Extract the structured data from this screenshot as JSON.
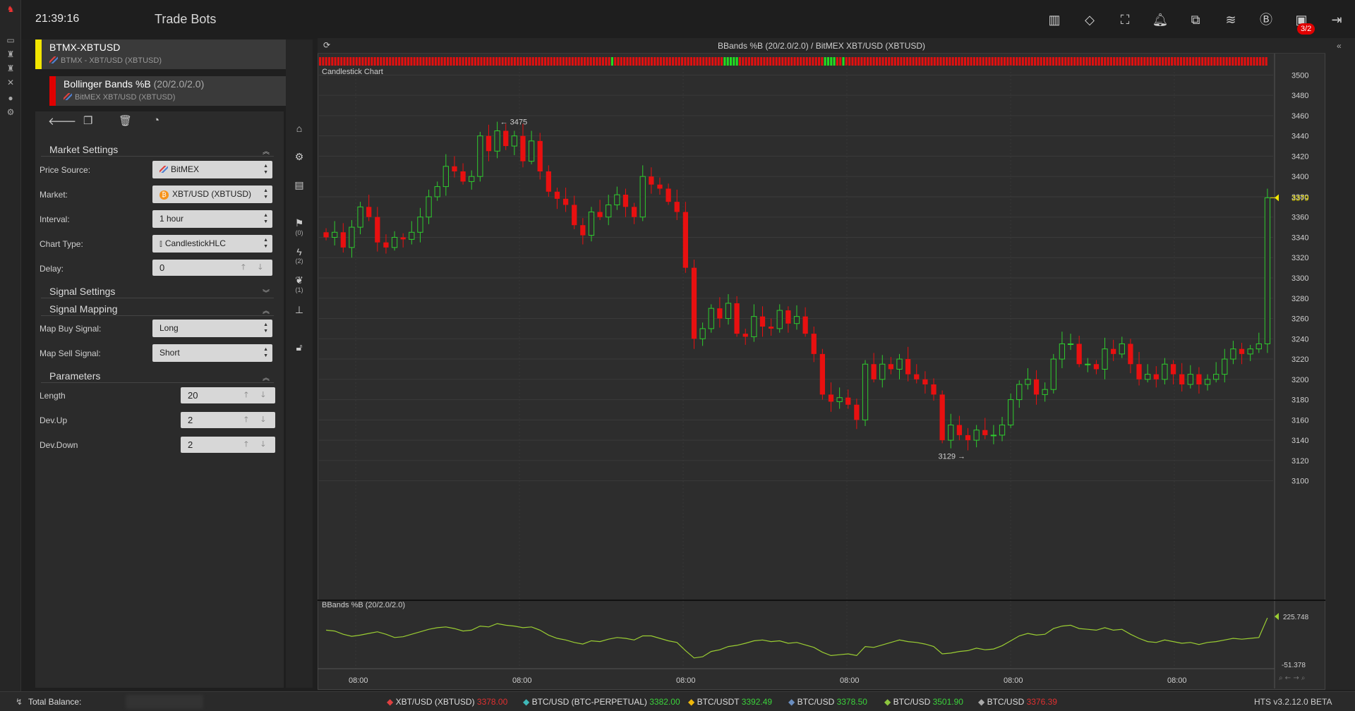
{
  "header": {
    "clock": "21:39:16",
    "title": "Trade Bots",
    "icons": [
      "map-icon",
      "tag-icon",
      "screenshot-icon",
      "bell-icon",
      "ticket-icon",
      "coins-icon",
      "bitcoin-sync-icon",
      "inbox-icon",
      "logout-icon"
    ],
    "badge": "3/2"
  },
  "bots": [
    {
      "name": "BTMX-XBTUSD",
      "sub": "BTMX - XBT/USD (XBTUSD)",
      "stripe_color": "#f2e600"
    },
    {
      "name": "Bollinger Bands %B",
      "params": "(20/2.0/2.0)",
      "sub": "BitMEX XBT/USD (XBTUSD)",
      "stripe_color": "#e00000"
    }
  ],
  "market_settings": {
    "title": "Market Settings",
    "price_source": {
      "label": "Price Source:",
      "value": "BitMEX"
    },
    "market": {
      "label": "Market:",
      "value": "XBT/USD (XBTUSD)"
    },
    "interval": {
      "label": "Interval:",
      "value": "1 hour"
    },
    "chart_type": {
      "label": "Chart Type:",
      "value": "CandlestickHLC"
    },
    "delay": {
      "label": "Delay:",
      "value": "0"
    }
  },
  "signal_settings": {
    "title": "Signal Settings"
  },
  "signal_mapping": {
    "title": "Signal Mapping",
    "buy": {
      "label": "Map Buy Signal:",
      "value": "Long"
    },
    "sell": {
      "label": "Map Sell Signal:",
      "value": "Short"
    }
  },
  "parameters": {
    "title": "Parameters",
    "length": {
      "label": "Length",
      "value": "20"
    },
    "dev_up": {
      "label": "Dev.Up",
      "value": "2"
    },
    "dev_down": {
      "label": "Dev.Down",
      "value": "2"
    }
  },
  "mid_tools": [
    {
      "icon": "home-icon"
    },
    {
      "icon": "gears-icon"
    },
    {
      "icon": "money-icon"
    },
    {
      "icon": "flag-icon",
      "count": "(0)"
    },
    {
      "icon": "lightning-icon",
      "count": "(2)"
    },
    {
      "icon": "leaf-icon",
      "count": "(1)"
    },
    {
      "icon": "sitemap-icon"
    },
    {
      "icon": "unlock-icon"
    }
  ],
  "chart": {
    "title": "BBands %B (20/2.0/2.0) / BitMEX XBT/USD (XBTUSD)",
    "main_label": "Candlestick Chart",
    "sub_label": "BBands %B (20/2.0/2.0)",
    "high_marker": "3475",
    "low_marker": "3129",
    "last_price": "3379",
    "sub_top_value": "225.748",
    "sub_bottom_value": "-51.378",
    "colors": {
      "up": "#2ecc2e",
      "down": "#e81010",
      "indicator": "#9acd32"
    }
  },
  "chart_data": {
    "type": "candlestick",
    "ylim": [
      3090,
      3510
    ],
    "y_ticks": [
      "3500",
      "3480",
      "3460",
      "3440",
      "3420",
      "3400",
      "3380",
      "3360",
      "3340",
      "3320",
      "3300",
      "3280",
      "3260",
      "3240",
      "3220",
      "3200",
      "3180",
      "3160",
      "3140",
      "3120",
      "3100"
    ],
    "x_ticks": [
      "08:00",
      "08:00",
      "08:00",
      "08:00",
      "08:00",
      "08:00"
    ],
    "close": [
      3340,
      3345,
      3330,
      3350,
      3370,
      3360,
      3335,
      3330,
      3340,
      3338,
      3345,
      3360,
      3380,
      3390,
      3410,
      3405,
      3395,
      3400,
      3440,
      3425,
      3445,
      3430,
      3440,
      3415,
      3435,
      3405,
      3385,
      3378,
      3372,
      3352,
      3342,
      3365,
      3360,
      3372,
      3382,
      3370,
      3360,
      3400,
      3392,
      3388,
      3375,
      3365,
      3310,
      3240,
      3250,
      3270,
      3260,
      3275,
      3245,
      3242,
      3262,
      3252,
      3250,
      3268,
      3255,
      3262,
      3245,
      3225,
      3185,
      3178,
      3182,
      3175,
      3160,
      3215,
      3200,
      3215,
      3210,
      3220,
      3205,
      3200,
      3195,
      3185,
      3140,
      3155,
      3145,
      3140,
      3150,
      3145,
      3145,
      3155,
      3180,
      3195,
      3200,
      3185,
      3190,
      3220,
      3235,
      3235,
      3215,
      3215,
      3210,
      3230,
      3225,
      3235,
      3215,
      3200,
      3205,
      3200,
      3215,
      3205,
      3195,
      3205,
      3195,
      3200,
      3205,
      3220,
      3230,
      3225,
      3230,
      3235,
      3379
    ],
    "indicator": [
      0.7,
      0.68,
      0.6,
      0.55,
      0.58,
      0.62,
      0.66,
      0.6,
      0.52,
      0.54,
      0.6,
      0.66,
      0.72,
      0.76,
      0.78,
      0.74,
      0.68,
      0.7,
      0.8,
      0.78,
      0.86,
      0.82,
      0.8,
      0.76,
      0.78,
      0.7,
      0.58,
      0.5,
      0.46,
      0.4,
      0.36,
      0.44,
      0.42,
      0.48,
      0.52,
      0.5,
      0.46,
      0.56,
      0.56,
      0.5,
      0.44,
      0.4,
      0.2,
      0.02,
      0.05,
      0.18,
      0.22,
      0.3,
      0.33,
      0.38,
      0.44,
      0.46,
      0.42,
      0.44,
      0.38,
      0.4,
      0.34,
      0.28,
      0.16,
      0.08,
      0.1,
      0.12,
      0.08,
      0.3,
      0.28,
      0.34,
      0.4,
      0.46,
      0.42,
      0.4,
      0.36,
      0.3,
      0.12,
      0.14,
      0.18,
      0.2,
      0.26,
      0.22,
      0.24,
      0.32,
      0.44,
      0.56,
      0.62,
      0.58,
      0.6,
      0.74,
      0.8,
      0.82,
      0.74,
      0.72,
      0.7,
      0.76,
      0.7,
      0.72,
      0.6,
      0.5,
      0.42,
      0.4,
      0.46,
      0.42,
      0.38,
      0.4,
      0.35,
      0.4,
      0.42,
      0.46,
      0.5,
      0.48,
      0.5,
      0.52,
      1.0
    ]
  },
  "signals": "rrrrrrrrrrrrrrrrrrrrrrrrrrrrrrrrrrrrrrrrrrrrrrrrrrrrrrrrrrrrrrrrrrrrrrrrrrrrrrrrrrrrrrrrrrrrrrrrgrrrrrrrrrrrrrrrrrrrrrrrrrrrrrrrrrrrrgggggrrrrrrrrrrrrrrrrrrrrrrrrrrrrggggrrgrrrrrrrrrrrrrrrrrrrrrrrrrrrrrrrrrrrrrrrrrrrrrrrrrrrrrrrrrrrrrrrrrrrrrrrrrrrrrrrrrrrrrrrrrrrrrrrrrrrrrrrrrrrrrrrrrrrrrrrrrrrrrrrrrrrrrrrrrrr",
  "status_bar": {
    "balance_label": "Total Balance:",
    "tickers": [
      {
        "name": "XBT/USD (XBTUSD)",
        "price": "3378.00",
        "dir": "dn",
        "icon": "bitmex-icon"
      },
      {
        "name": "BTC/USD (BTC-PERPETUAL)",
        "price": "3382.00",
        "dir": "up",
        "icon": "deribit-icon"
      },
      {
        "name": "BTC/USDT",
        "price": "3392.49",
        "dir": "up",
        "icon": "binance-icon"
      },
      {
        "name": "BTC/USD",
        "price": "3378.50",
        "dir": "up",
        "icon": "bitfinex-icon"
      },
      {
        "name": "BTC/USD",
        "price": "3501.90",
        "dir": "up",
        "icon": "leaf-exchange-icon"
      },
      {
        "name": "BTC/USD",
        "price": "3376.39",
        "dir": "dn",
        "icon": "exchange-icon"
      }
    ],
    "version": "HTS v3.2.12.0 BETA"
  }
}
